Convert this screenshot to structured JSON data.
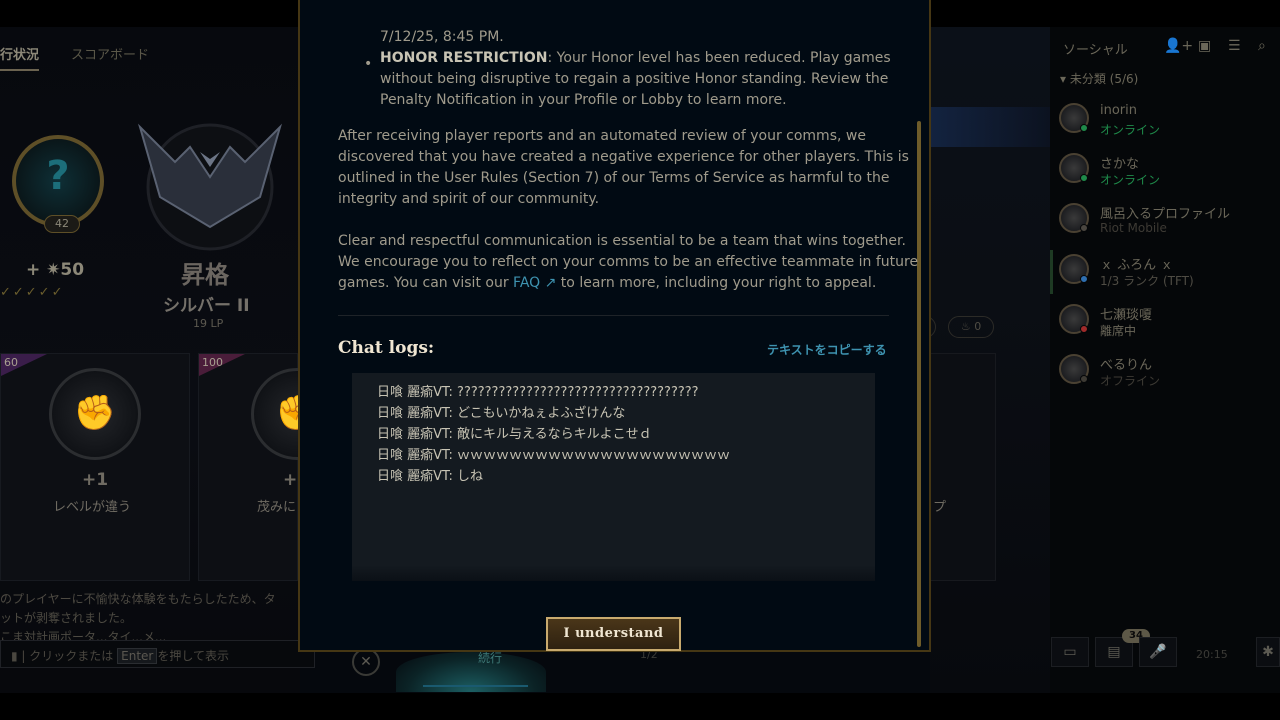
{
  "profile": {
    "tabs": [
      {
        "label": "行状況"
      },
      {
        "label": "スコアボード"
      }
    ],
    "mastery_level": "42",
    "mastery_points": "+ ✷50",
    "checks": "✓✓✓✓✓",
    "rank_title": "昇格",
    "rank_tier": "シルバー II",
    "rank_lp": "19 LP",
    "cards": [
      {
        "ribbon": "60",
        "plus": "+1",
        "label": "レベルが違う"
      },
      {
        "ribbon": "100",
        "plus": "+",
        "label": "茂みに"
      }
    ],
    "honor_text_1": "のプレイヤーに不愉快な体験をもたらしたため、タ",
    "honor_text_2": "ットが剥奪されました。",
    "honor_text_3": "こま対計画ポータ...タイ...メ...",
    "chat_input_pre": "クリックまたは",
    "chat_input_key": "Enter",
    "chat_input_post": "を押して表示",
    "bottom_continue": "続行",
    "bottom_count": "1/2",
    "mid_label": "プ",
    "mid_pill_value": "0"
  },
  "social": {
    "title": "ソーシャル",
    "group_header": "▾ 未分類 (5/6)",
    "friends": [
      {
        "name": "inorin",
        "status": "オンライン",
        "status_color": "#1f8a4a",
        "dot_color": "#1f8a4a"
      },
      {
        "name": "さかな",
        "status": "オンライン",
        "status_color": "#1f8a4a",
        "dot_color": "#1f8a4a"
      },
      {
        "name": "風呂入るプロファイル",
        "status": "Riot Mobile",
        "status_color": "#3d3a34",
        "dot_color": "#4a4640"
      },
      {
        "name": "ｘ ふろん ｘ",
        "status": "1/3 ランク (TFT)",
        "status_color": "#4f4c44",
        "dot_color": "#2f6fb0"
      },
      {
        "name": "七瀬琰嗄",
        "status": "離席中",
        "status_color": "#6b6759",
        "dot_color": "#a02a2a"
      },
      {
        "name": "べるりん",
        "status": "オフライン",
        "status_color": "#3d3a34",
        "dot_color": "#3d3a34"
      }
    ],
    "notification_count": "34",
    "clock": "20:15"
  },
  "modal": {
    "date_fragment": "7/12/25, 8:45 PM.",
    "honor_restriction_label": "HONOR RESTRICTION",
    "honor_restriction_line1": ": Your Honor level has been reduced. Play games",
    "honor_restriction_line2": "without being disruptive to regain a positive Honor standing. Review the",
    "honor_restriction_line3": "Penalty Notification in your Profile or Lobby to learn more.",
    "para1_line1": "After receiving player reports and an automated review of your comms, we",
    "para1_line2": "discovered that you have created a negative experience for other players. This is",
    "para1_line3": "outlined in the User Rules (Section 7) of our Terms of Service as harmful to the",
    "para1_line4": "integrity and spirit of our community.",
    "para2_line1": "Clear and respectful communication is essential to be a team that wins together.",
    "para2_line2": "We encourage you to reflect on your comms to be an effective teammate in future",
    "para2_line3_pre": "games. You can visit our ",
    "faq_label": "FAQ ↗",
    "para2_line3_post": " to learn more, including your right to appeal.",
    "chat_logs_heading": "Chat logs:",
    "copy_text_label": "テキストをコピーする",
    "chat_lines": [
      {
        "speaker": "日喰 麗瘉VT:",
        "message": " ???????????????????????????????????"
      },
      {
        "speaker": "日喰 麗瘉VT:",
        "message": " どこもいかねぇよふざけんな"
      },
      {
        "speaker": "日喰 麗瘉VT:",
        "message": " 敵にキル与えるならキルよこせｄ"
      },
      {
        "speaker": "日喰 麗瘉VT:",
        "message": " ｗｗｗｗｗｗｗｗｗｗｗｗｗｗｗｗｗｗｗｗｗ"
      },
      {
        "speaker": "日喰 麗瘉VT:",
        "message": " しね"
      }
    ],
    "understand_label": "I understand"
  },
  "colors": {
    "modal_border": "#463714",
    "gold_button_border": "#c8aa6e",
    "link_blue": "#3e93b0",
    "modal_bg": "#010a13"
  }
}
